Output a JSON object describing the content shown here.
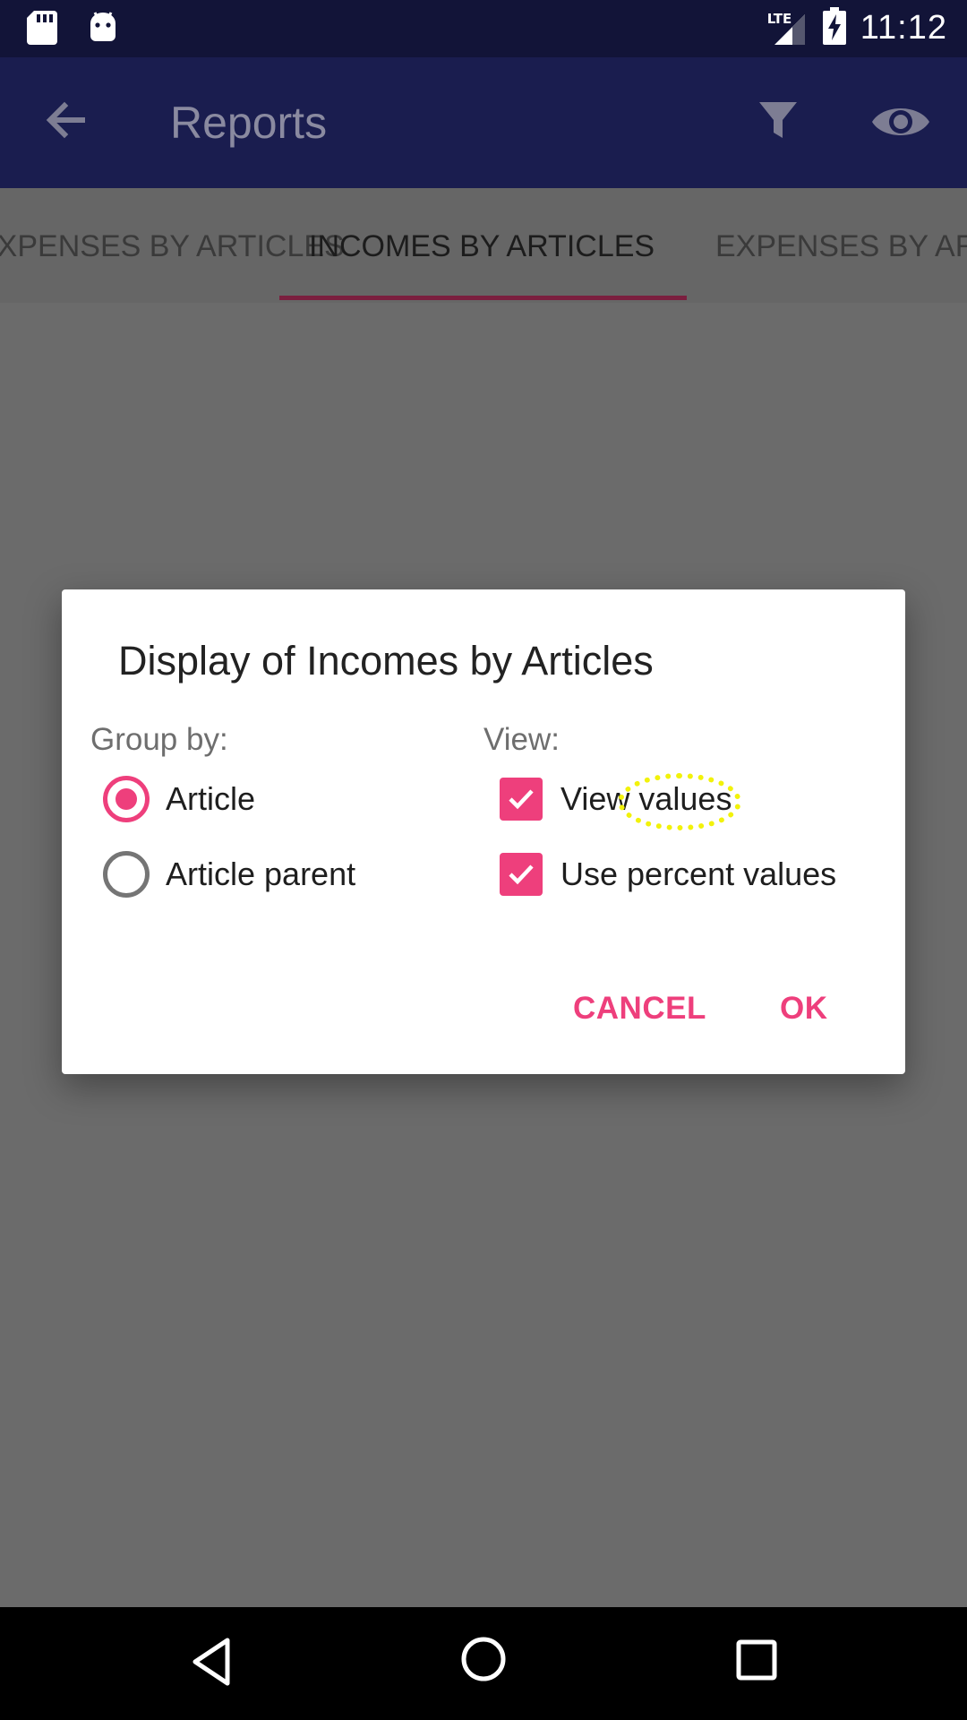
{
  "status_bar": {
    "time": "11:12",
    "network": "LTE",
    "icons": [
      "sd-card-icon",
      "android-icon",
      "signal-icon",
      "battery-charging-icon"
    ]
  },
  "app_bar": {
    "title": "Reports",
    "icons": [
      "back-arrow-icon",
      "filter-icon",
      "eye-icon"
    ]
  },
  "tabs": [
    {
      "label": "EXPENSES BY ARTICLES"
    },
    {
      "label": "INCOMES BY ARTICLES",
      "selected": true
    },
    {
      "label": "EXPENSES BY ARTICLES"
    }
  ],
  "dialog": {
    "title": "Display of Incomes by Articles",
    "group_by": {
      "label": "Group by:",
      "options": [
        {
          "label": "Article",
          "checked": true
        },
        {
          "label": "Article parent",
          "checked": false
        }
      ]
    },
    "view": {
      "label": "View:",
      "options": [
        {
          "label": "View values",
          "checked": true
        },
        {
          "label": "Use percent values",
          "checked": true
        }
      ]
    },
    "cancel_label": "CANCEL",
    "ok_label": "OK"
  },
  "nav_bar": {
    "icons": [
      "nav-back-icon",
      "nav-home-icon",
      "nav-recents-icon"
    ]
  },
  "colors": {
    "status_bar": "#121438",
    "app_bar": "#1a1d4f",
    "accent": "#ee3f7c",
    "scrim": "#6b6b6b",
    "tab_indicator": "#7b1f3f",
    "highlight": "#f2f20a"
  }
}
